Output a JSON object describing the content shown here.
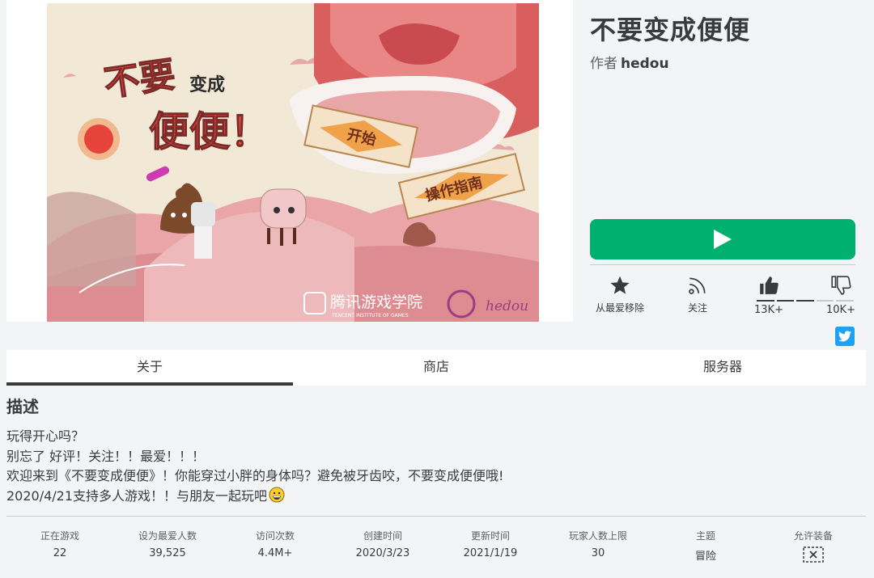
{
  "game": {
    "title": "不要变成便便",
    "author_prefix": "作者",
    "author_name": "hedou"
  },
  "thumbnail": {
    "title_line1": "不要",
    "title_small": "变成",
    "title_line2": "便便！",
    "start_button": "开始",
    "guide_button": "操作指南",
    "partner_logo": "腾讯游戏学院",
    "partner_logo_en": "TENCENT INSTITUTE OF GAMES",
    "signature": "hedou"
  },
  "actions": {
    "favorite_label": "从最爱移除",
    "follow_label": "关注",
    "upvotes": "13K+",
    "downvotes": "10K+",
    "upvote_fraction": 0.57
  },
  "tabs": [
    {
      "label": "关于"
    },
    {
      "label": "商店"
    },
    {
      "label": "服务器"
    }
  ],
  "description": {
    "heading": "描述",
    "lines": [
      "玩得开心吗？",
      "别忘了 好评！关注！！最爱！！！",
      "欢迎来到《不要变成便便》！你能穿过小胖的身体吗？避免被牙齿咬，不要变成便便哦!",
      "2020/4/21支持多人游戏！！与朋友一起玩吧"
    ]
  },
  "stats": [
    {
      "label": "正在游戏",
      "value": "22"
    },
    {
      "label": "设为最爱人数",
      "value": "39,525"
    },
    {
      "label": "访问次数",
      "value": "4.4M+"
    },
    {
      "label": "创建时间",
      "value": "2020/3/23"
    },
    {
      "label": "更新时间",
      "value": "2021/1/19"
    },
    {
      "label": "玩家人数上限",
      "value": "30"
    },
    {
      "label": "主题",
      "value": "冒险"
    },
    {
      "label": "允许装备",
      "value": ""
    }
  ],
  "icons": {
    "favorite": "star-icon",
    "follow": "rss-icon",
    "upvote": "thumbs-up-icon",
    "downvote": "thumbs-down-icon",
    "share": "twitter-icon",
    "play": "play-icon",
    "gear": "gear-not-allowed-icon"
  },
  "colors": {
    "play_button": "#00b06f",
    "twitter": "#1da1f2",
    "text": "#393b3d",
    "page_bg": "#f2f4f5"
  }
}
